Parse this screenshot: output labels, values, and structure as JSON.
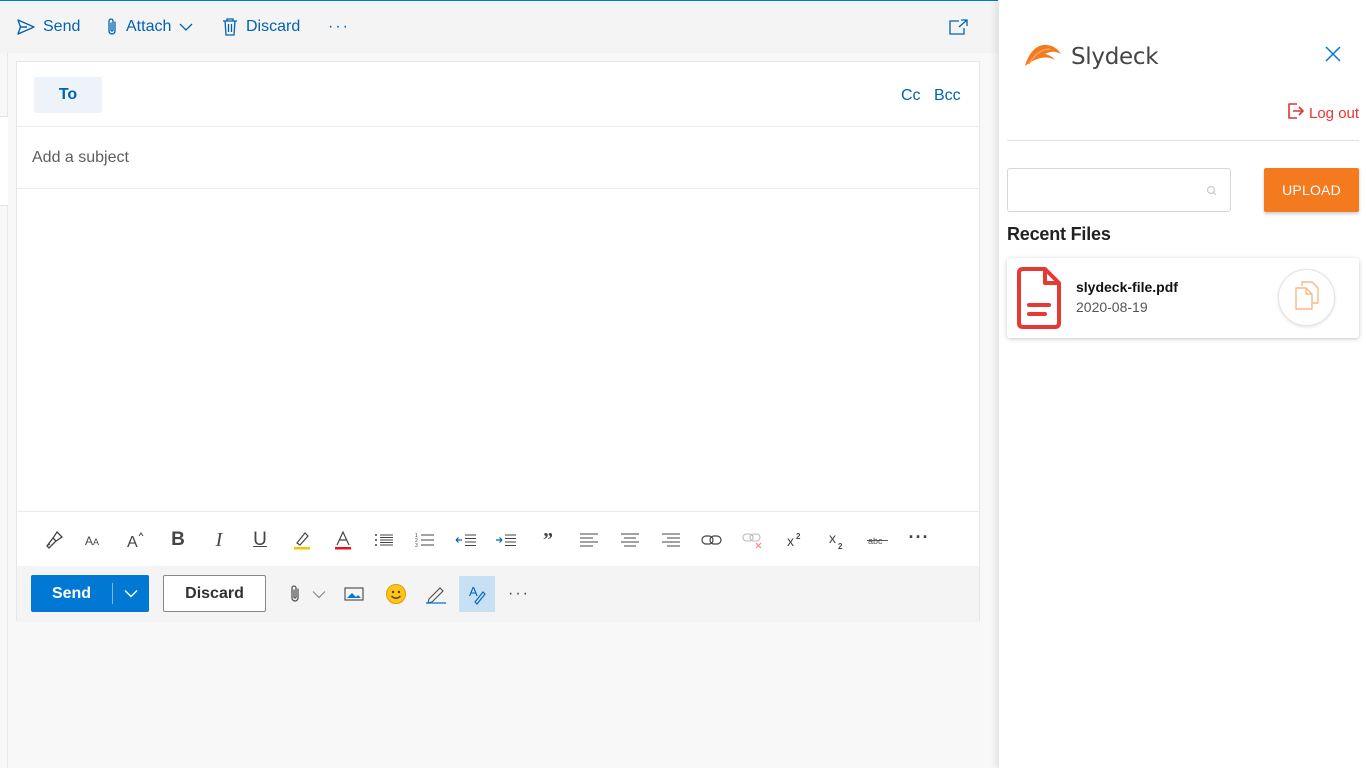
{
  "topbar": {
    "send_label": "Send",
    "attach_label": "Attach",
    "discard_label": "Discard",
    "more_label": "···"
  },
  "compose": {
    "to_label": "To",
    "cc_label": "Cc",
    "bcc_label": "Bcc",
    "subject_placeholder": "Add a subject",
    "subject_value": ""
  },
  "format_toolbar": {
    "icons": [
      "format-painter-icon",
      "font-size-icon",
      "grow-font-icon",
      "bold-icon",
      "italic-icon",
      "underline-icon",
      "highlight-icon",
      "font-color-icon",
      "bullets-icon",
      "numbering-icon",
      "decrease-indent-icon",
      "increase-indent-icon",
      "quote-icon",
      "align-left-icon",
      "align-center-icon",
      "align-right-icon",
      "insert-link-icon",
      "remove-link-icon",
      "superscript-icon",
      "subscript-icon",
      "strikethrough-icon",
      "more-options-icon"
    ],
    "bold_label": "B",
    "italic_label": "I",
    "underline_label": "U",
    "quote_label": "”",
    "more_label": "···"
  },
  "action_bar": {
    "send_label": "Send",
    "discard_label": "Discard",
    "more_label": "···"
  },
  "panel": {
    "brand_name": "Slydeck",
    "logout_label": "Log out",
    "search_value": "",
    "upload_label": "UPLOAD",
    "recent_title": "Recent Files",
    "files": [
      {
        "name": "slydeck-file.pdf",
        "date": "2020-08-19"
      }
    ],
    "colors": {
      "accent": "#f47a20",
      "logout": "#e33333",
      "pdf": "#e53935"
    }
  },
  "colors": {
    "primary": "#0078d4",
    "link": "#0063b1"
  }
}
